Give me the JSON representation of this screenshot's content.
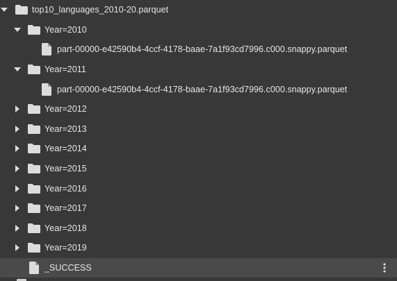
{
  "root": {
    "label": "top10_languages_2010-20.parquet",
    "icon": "folder-icon",
    "expanded": true
  },
  "partitions": [
    {
      "label": "Year=2010",
      "expanded": true,
      "file": "part-00000-e42590b4-4ccf-4178-baae-7a1f93cd7996.c000.snappy.parquet"
    },
    {
      "label": "Year=2011",
      "expanded": true,
      "file": "part-00000-e42590b4-4ccf-4178-baae-7a1f93cd7996.c000.snappy.parquet"
    },
    {
      "label": "Year=2012",
      "expanded": false
    },
    {
      "label": "Year=2013",
      "expanded": false
    },
    {
      "label": "Year=2014",
      "expanded": false
    },
    {
      "label": "Year=2015",
      "expanded": false
    },
    {
      "label": "Year=2016",
      "expanded": false
    },
    {
      "label": "Year=2017",
      "expanded": false
    },
    {
      "label": "Year=2018",
      "expanded": false
    },
    {
      "label": "Year=2019",
      "expanded": false
    }
  ],
  "success_file": {
    "label": "_SUCCESS",
    "icon": "file-icon",
    "selected": true,
    "menu_icon": "more-vert-icon"
  },
  "colors": {
    "background": "#383838",
    "selected_row": "#4a4a4a",
    "text": "#e6e6e6",
    "icon": "#dcdcdc"
  }
}
